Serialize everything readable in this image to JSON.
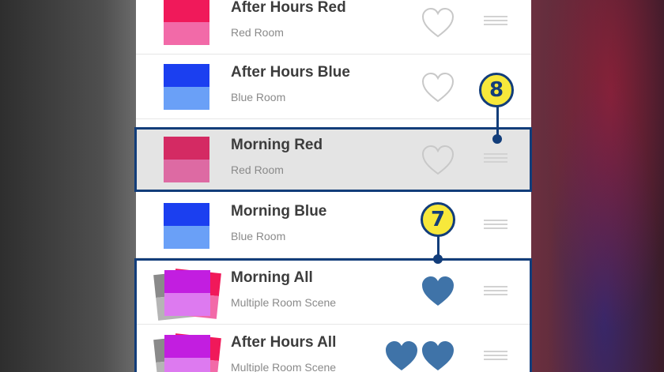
{
  "scenes": [
    {
      "title": "After Hours Red",
      "room": "Red Room",
      "favorite": false,
      "colors": {
        "top": "#f0195a",
        "bottom": "#f26aa8"
      }
    },
    {
      "title": "After Hours Blue",
      "room": "Blue Room",
      "favorite": false,
      "colors": {
        "top": "#1b3ff0",
        "bottom": "#6aa0f7"
      }
    },
    {
      "title": "Morning Red",
      "room": "Red Room",
      "favorite": false,
      "selected": true,
      "colors": {
        "top": "#d42a63",
        "bottom": "#dd6aa3"
      }
    },
    {
      "title": "Morning Blue",
      "room": "Blue Room",
      "favorite": false,
      "colors": {
        "top": "#1b3ff0",
        "bottom": "#6aa0f7"
      }
    },
    {
      "title": "Morning All",
      "room": "Multiple Room Scene",
      "favorite": true,
      "colors": {
        "top": "#c21ee0",
        "bottom": "#dd7af0"
      }
    },
    {
      "title": "After Hours All",
      "room": "Multiple Room Scene",
      "favorite": true,
      "colors": {
        "top": "#c21ee0",
        "bottom": "#dd7af0"
      }
    }
  ],
  "callouts": {
    "badge_8": "8",
    "badge_7": "7"
  },
  "theme": {
    "heart_filled": "#3f73a8",
    "heart_outline": "#c8c8c8",
    "callout_border": "#123d7a",
    "callout_fill": "#f7e83b"
  }
}
